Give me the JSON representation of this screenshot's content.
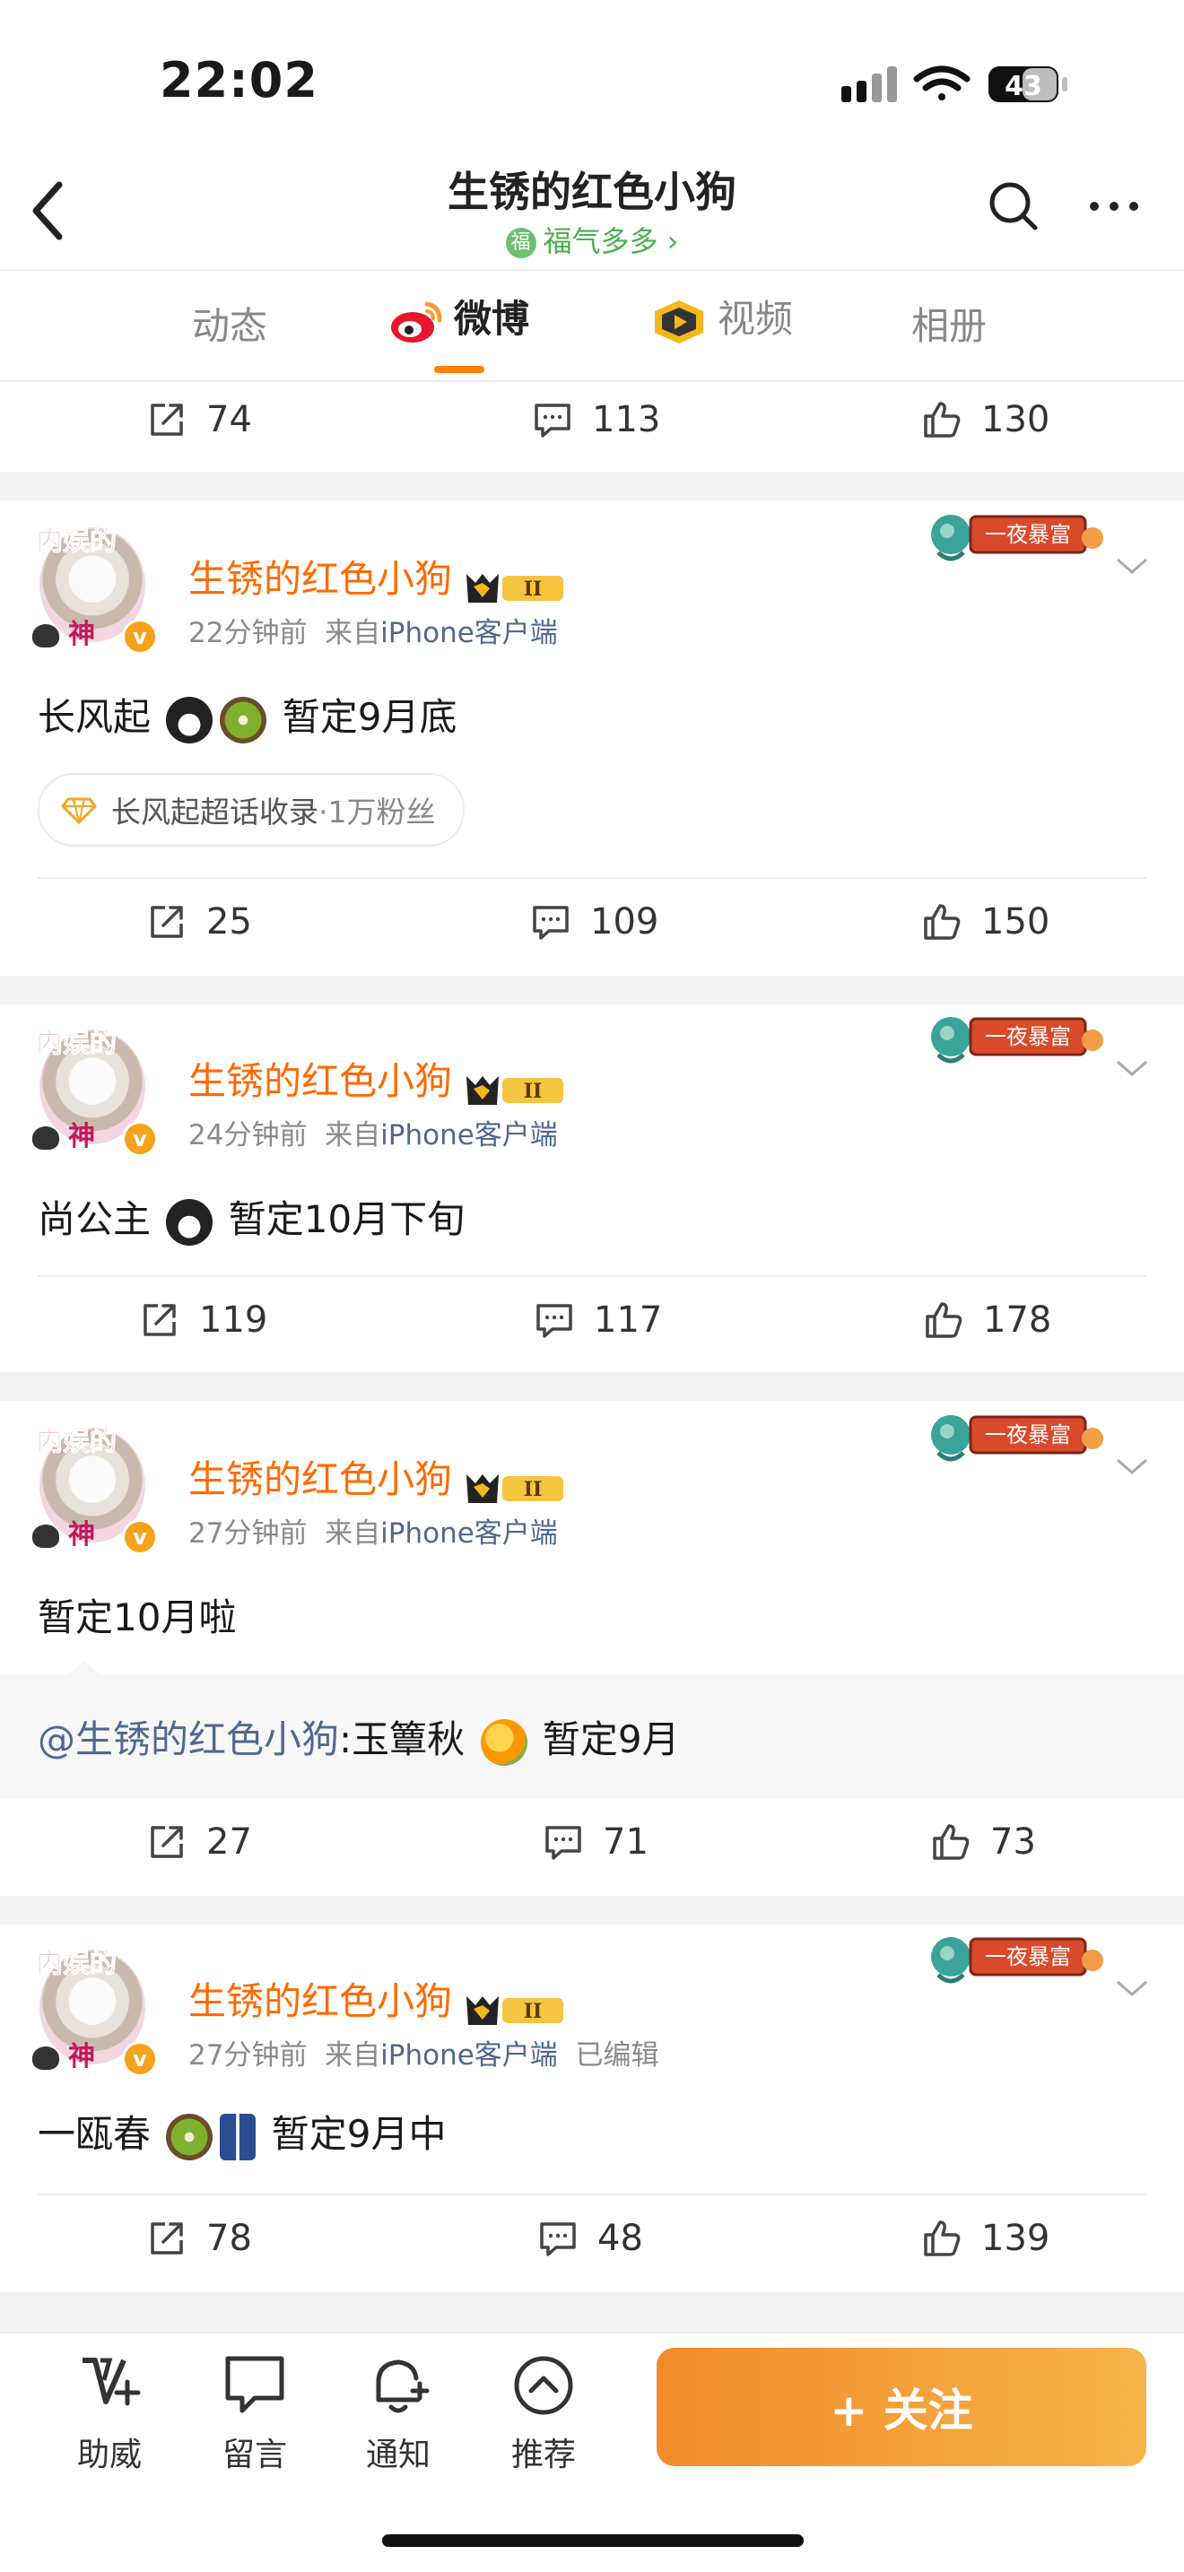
{
  "status": {
    "time": "22:02",
    "battery": "43"
  },
  "header": {
    "title": "生锈的红色小狗",
    "subtitle": "福气多多",
    "subtitle_chevron": "›"
  },
  "tabs": [
    {
      "label": "动态"
    },
    {
      "label": "微博"
    },
    {
      "label": "视频"
    },
    {
      "label": "相册"
    }
  ],
  "top_actions": {
    "repost": "74",
    "comment": "113",
    "like": "130"
  },
  "posts": [
    {
      "username": "生锈的红色小狗",
      "vip_level": "II",
      "time": "22分钟前",
      "source_prefix": "来自",
      "source": "iPhone客户端",
      "edited": "",
      "text_a": "长风起",
      "text_b": "暂定9月底",
      "emojis": [
        "penguin",
        "kiwi"
      ],
      "badge": "一夜暴富",
      "supertopic": {
        "name": "长风起超话收录",
        "fans": "·1万粉丝"
      },
      "actions": {
        "repost": "25",
        "comment": "109",
        "like": "150"
      }
    },
    {
      "username": "生锈的红色小狗",
      "vip_level": "II",
      "time": "24分钟前",
      "source_prefix": "来自",
      "source": "iPhone客户端",
      "text_a": "尚公主",
      "text_b": "暂定10月下旬",
      "emojis": [
        "penguin"
      ],
      "badge": "一夜暴富",
      "actions": {
        "repost": "119",
        "comment": "117",
        "like": "178"
      }
    },
    {
      "username": "生锈的红色小狗",
      "vip_level": "II",
      "time": "27分钟前",
      "source_prefix": "来自",
      "source": "iPhone客户端",
      "text_a": "暂定10月啦",
      "badge": "一夜暴富",
      "repost": {
        "at": "@生锈的红色小狗",
        "text_a": ":玉簟秋",
        "text_b": "暂定9月",
        "emojis": [
          "mango"
        ]
      },
      "actions": {
        "repost": "27",
        "comment": "71",
        "like": "73"
      }
    },
    {
      "username": "生锈的红色小狗",
      "vip_level": "II",
      "time": "27分钟前",
      "source_prefix": "来自",
      "source": "iPhone客户端",
      "edited": "已编辑",
      "text_a": "一瓯春",
      "text_b": "暂定9月中",
      "emojis": [
        "kiwi",
        "jeans"
      ],
      "badge": "一夜暴富",
      "actions": {
        "repost": "78",
        "comment": "48",
        "like": "139"
      }
    }
  ],
  "avatar": {
    "top_text": "内娱的",
    "bottom_text": "神",
    "badge": "v"
  },
  "bottom_bar": {
    "items": [
      {
        "label": "助威",
        "icon": "cheer-icon"
      },
      {
        "label": "留言",
        "icon": "message-icon"
      },
      {
        "label": "通知",
        "icon": "bell-add-icon"
      },
      {
        "label": "推荐",
        "icon": "recommend-icon"
      }
    ],
    "follow_label": "+ 关注"
  },
  "colors": {
    "accent": "#ff8200",
    "username": "#ff6a00",
    "link": "#50688f",
    "follow_start": "#f28a2a",
    "follow_end": "#f6b54a"
  }
}
